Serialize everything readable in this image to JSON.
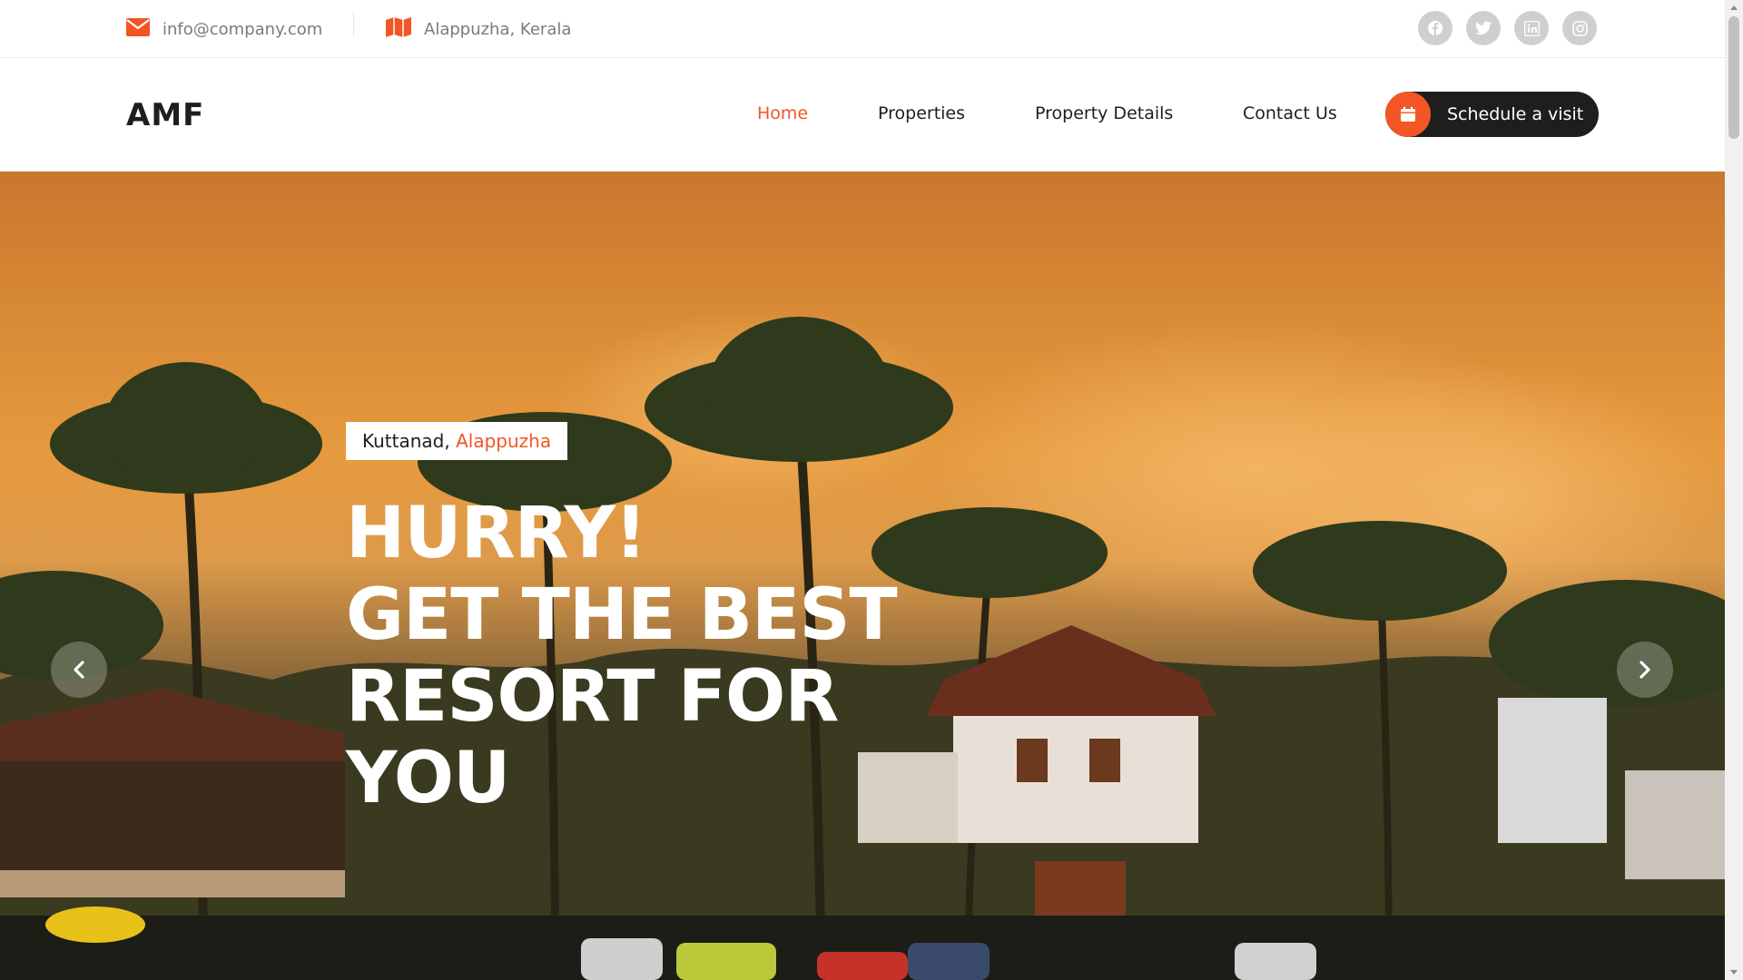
{
  "topbar": {
    "email": "info@company.com",
    "address": "Alappuzha, Kerala",
    "socials": [
      "facebook-icon",
      "twitter-icon",
      "linkedin-icon",
      "instagram-icon"
    ]
  },
  "header": {
    "logo": "AMF",
    "nav": [
      {
        "label": "Home",
        "active": true
      },
      {
        "label": "Properties",
        "active": false
      },
      {
        "label": "Property Details",
        "active": false
      },
      {
        "label": "Contact Us",
        "active": false
      }
    ],
    "cta_label": "Schedule a visit",
    "cta_icon": "calendar-icon"
  },
  "hero": {
    "location_prefix": "Kuttanad, ",
    "location_highlight": "Alappuzha",
    "title_lines": [
      "HURRY!",
      "GET THE BEST",
      "RESORT FOR",
      "YOU"
    ],
    "prev_icon": "chevron-left-icon",
    "next_icon": "chevron-right-icon"
  },
  "colors": {
    "accent": "#f35525",
    "dark": "#1e1e1e",
    "muted": "#7a7a7a"
  }
}
